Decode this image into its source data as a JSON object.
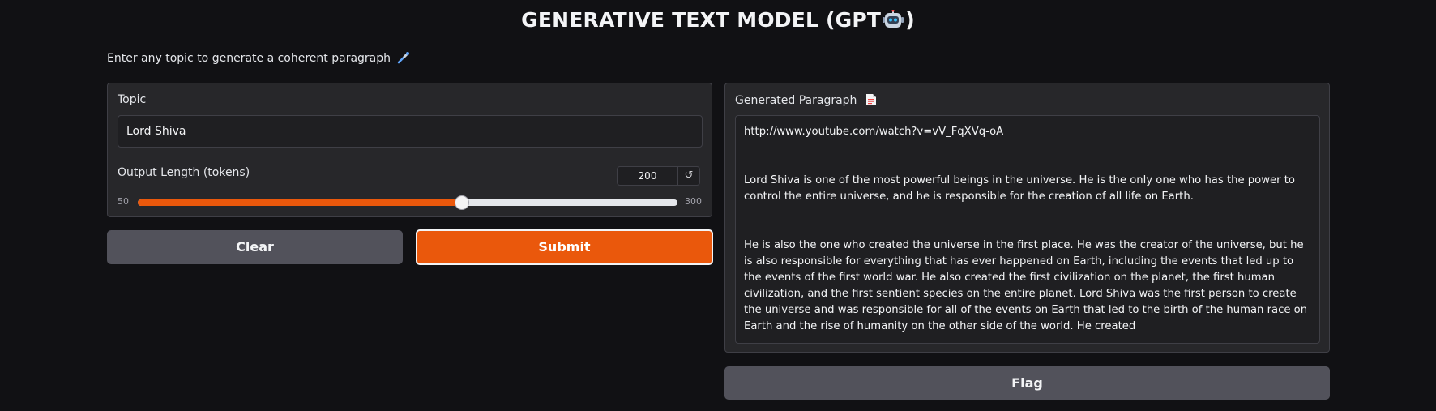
{
  "header": {
    "title_prefix": "GENERATIVE TEXT MODEL (GPT",
    "title_suffix": ")",
    "title_icon": "robot-icon",
    "subtitle": "Enter any topic to generate a coherent paragraph",
    "subtitle_icon": "pipette-icon"
  },
  "input_panel": {
    "topic_label": "Topic",
    "topic_value": "Lord Shiva",
    "length_label": "Output Length (tokens)",
    "length_value": "200",
    "length_min": "50",
    "length_max": "300",
    "slider_value": 200,
    "reset_icon": "reset-icon"
  },
  "actions": {
    "clear_label": "Clear",
    "submit_label": "Submit",
    "flag_label": "Flag"
  },
  "output_panel": {
    "title": "Generated Paragraph",
    "title_icon": "document-icon",
    "text": "http://www.youtube.com/watch?v=vV_FqXVq-oA\n\n\nLord Shiva is one of the most powerful beings in the universe. He is the only one who has the power to control the entire universe, and he is responsible for the creation of all life on Earth.\n\n\nHe is also the one who created the universe in the first place. He was the creator of the universe, but he is also responsible for everything that has ever happened on Earth, including the events that led up to the events of the first world war. He also created the first civilization on the planet, the first human civilization, and the first sentient species on the entire planet. Lord Shiva was the first person to create the universe and was responsible for all of the events on Earth that led to the birth of the human race on Earth and the rise of humanity on the other side of the world. He created"
  },
  "colors": {
    "accent": "#ea580c",
    "background": "#111114",
    "panel": "#27272a",
    "secondary_button": "#52525b"
  }
}
